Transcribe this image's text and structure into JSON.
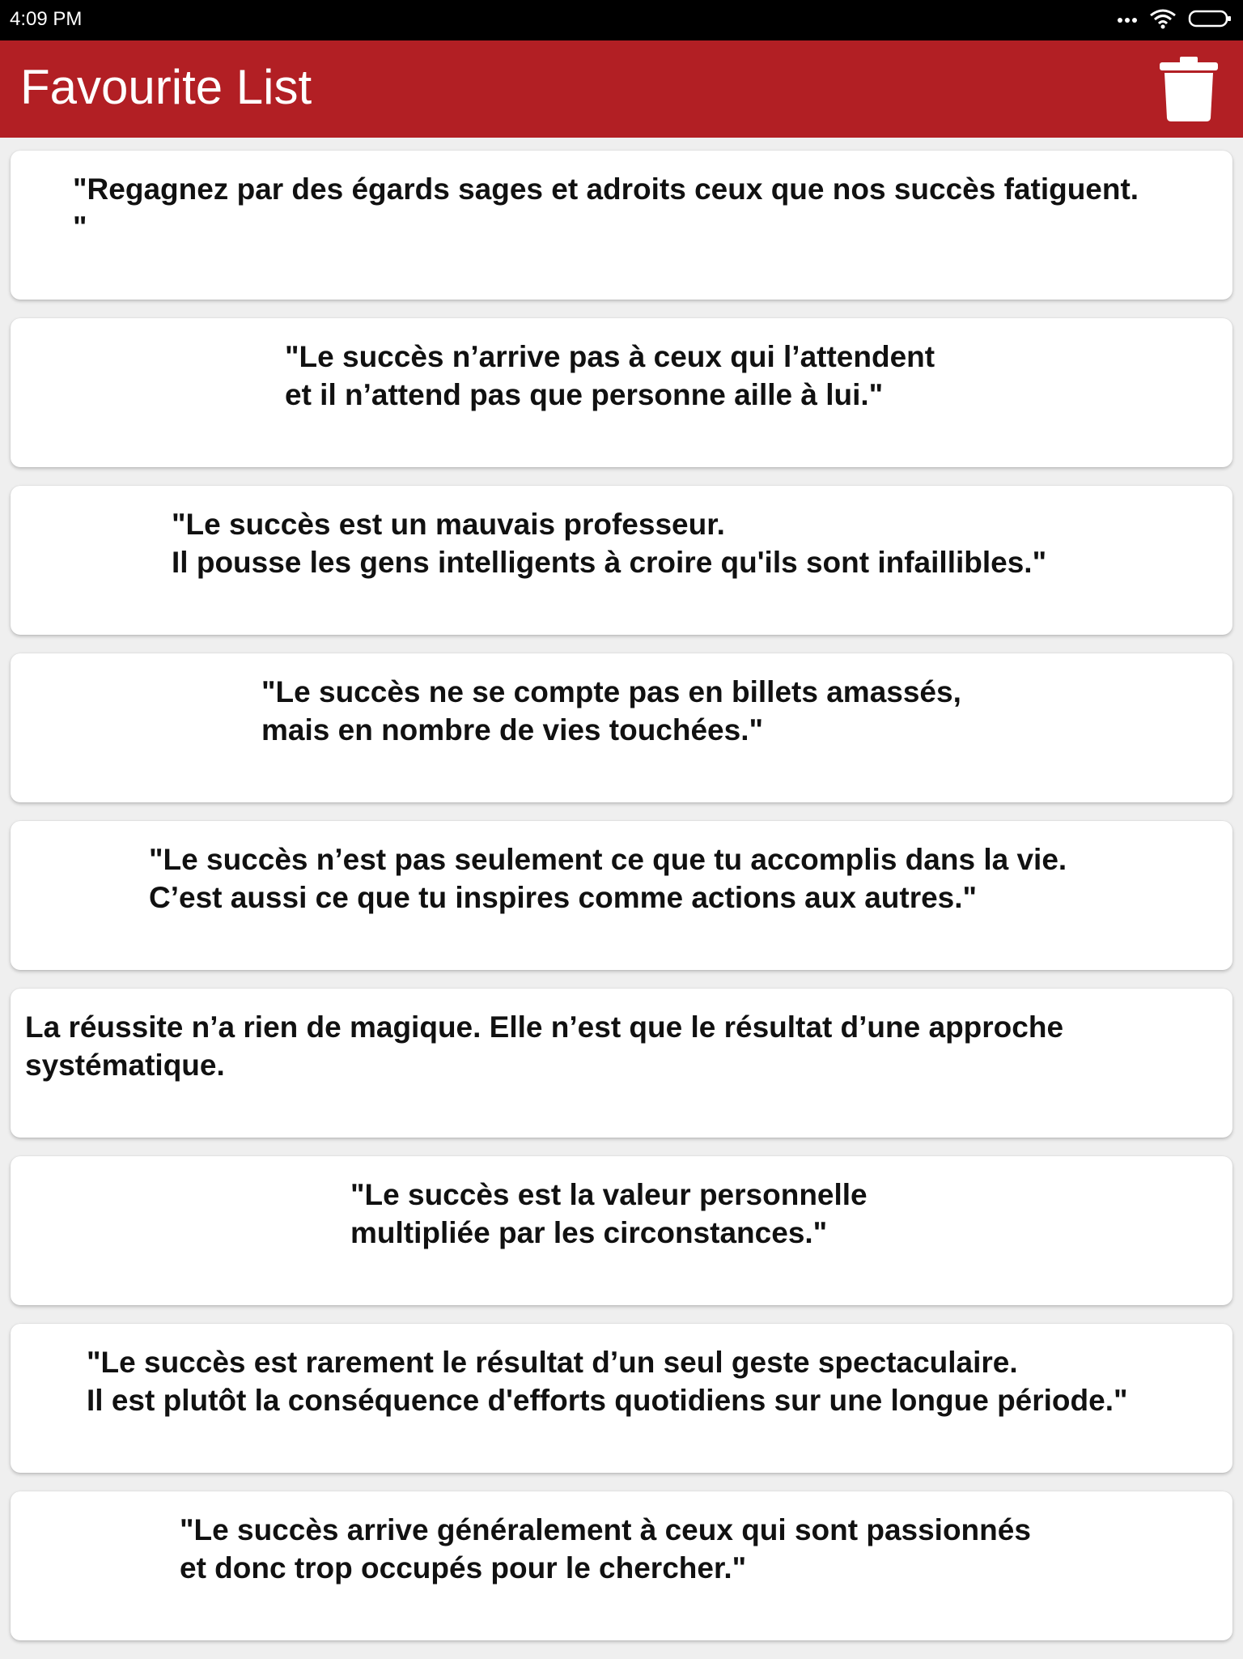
{
  "status_bar": {
    "time": "4:09 PM",
    "icons": [
      "more-dots-icon",
      "wifi-icon",
      "battery-icon"
    ]
  },
  "app_bar": {
    "title": "Favourite List",
    "background": "#b21f24",
    "delete_icon": "trash-icon"
  },
  "quotes": [
    {
      "text": "\"Regagnez par des égards sages et adroits ceux que nos succès fatiguent.\n\""
    },
    {
      "text": "\"Le succès n’arrive pas à ceux qui l’attendent\net il n’attend pas que personne aille à lui.\""
    },
    {
      "text": "\"Le succès est un mauvais professeur.\nIl pousse les gens intelligents à croire qu'ils sont infaillibles.\""
    },
    {
      "text": "\"Le succès ne se compte pas en billets amassés,\nmais en nombre de vies touchées.\""
    },
    {
      "text": "\"Le succès n’est pas seulement ce que tu accomplis dans la vie.\nC’est aussi ce que tu inspires comme actions aux autres.\""
    },
    {
      "text": "La réussite n’a rien de magique. Elle n’est que le résultat d’une approche\nsystématique."
    },
    {
      "text": "\"Le succès est la valeur personnelle\nmultipliée par les circonstances.\""
    },
    {
      "text": "\"Le succès est rarement le résultat d’un seul geste spectaculaire.\nIl est plutôt la conséquence d'efforts quotidiens sur une longue période.\""
    },
    {
      "text": "\"Le succès arrive généralement à ceux qui sont passionnés\net donc trop occupés pour le chercher.\""
    }
  ]
}
